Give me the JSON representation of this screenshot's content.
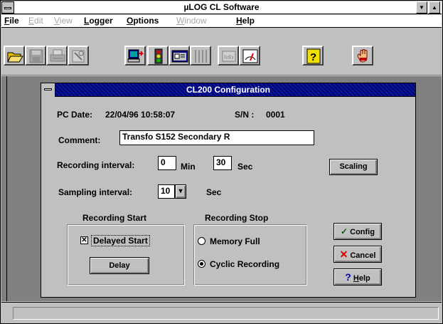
{
  "window": {
    "title": "µLOG CL Software"
  },
  "menu": [
    {
      "label": "File",
      "u": "F",
      "rest": "ile",
      "enabled": true
    },
    {
      "label": "Edit",
      "u": "E",
      "rest": "dit",
      "enabled": false
    },
    {
      "label": "View",
      "u": "V",
      "rest": "iew",
      "enabled": false
    },
    {
      "label": "Logger",
      "u": "L",
      "rest": "ogger",
      "enabled": true
    },
    {
      "label": "Options",
      "u": "O",
      "rest": "ptions",
      "enabled": true
    },
    {
      "label": "Window",
      "u": "W",
      "rest": "indow",
      "enabled": false
    },
    {
      "label": "Help",
      "u": "H",
      "rest": "elp",
      "enabled": true
    }
  ],
  "toolbar": {
    "icons": [
      "folder-open-icon",
      "save-disk-icon",
      "printer-icon",
      "tools-icon",
      "computer-transfer-icon",
      "traffic-light-icon",
      "data-view-icon",
      "channels-icon",
      "info-icon",
      "gauge-icon",
      "help-question-icon",
      "stop-hand-icon"
    ]
  },
  "dialog": {
    "title": "CL200 Configuration",
    "pc_date_label": "PC Date:",
    "pc_date": "22/04/96 10:58:07",
    "sn_label": "S/N  :",
    "sn_value": "0001",
    "comment_label": "Comment:",
    "comment_value": "Transfo S152 Secondary R",
    "recording_interval_label": "Recording interval:",
    "recording_min": "0",
    "min_unit": "Min",
    "recording_sec": "30",
    "sec_unit": "Sec",
    "scaling_button": "Scaling",
    "sampling_interval_label": "Sampling interval:",
    "sampling_value": "10",
    "sampling_unit": "Sec",
    "recording_start_title": "Recording Start",
    "delayed_start_label": "Delayed Start",
    "delayed_start_checked": true,
    "delay_button": "Delay",
    "recording_stop_title": "Recording Stop",
    "memory_full_label": "Memory Full",
    "cyclic_recording_label": "Cyclic Recording",
    "stop_mode_selected": "Cyclic Recording",
    "config_button": "Config",
    "cancel_button": "Cancel",
    "help_button_u": "H",
    "help_button_rest": "elp"
  },
  "status": {
    "text": ""
  }
}
